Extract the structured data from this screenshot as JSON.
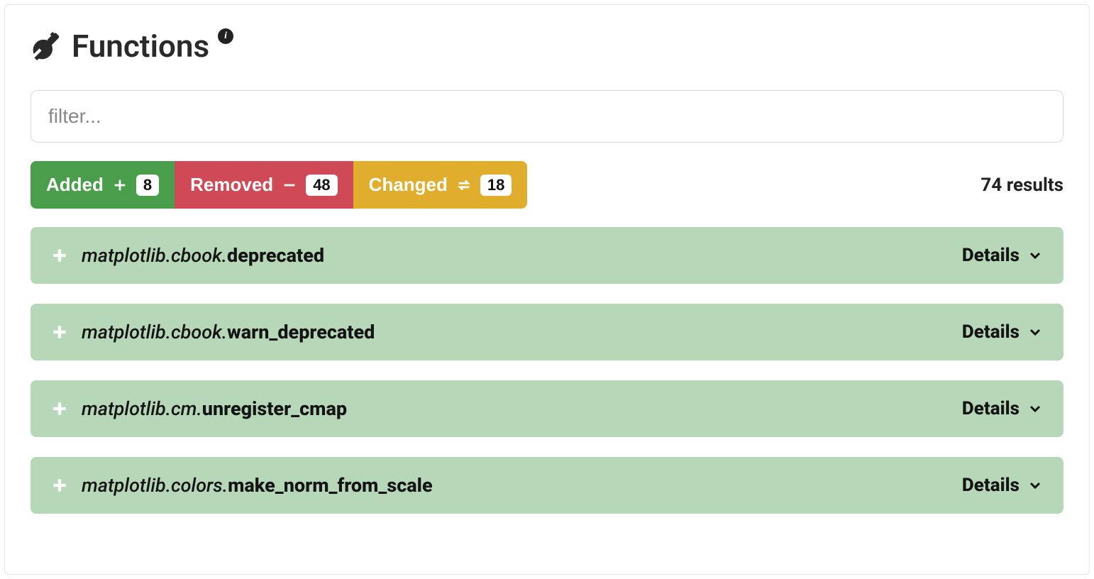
{
  "section": {
    "title": "Functions"
  },
  "filter": {
    "placeholder": "filter..."
  },
  "counts": {
    "added_label": "Added",
    "added_count": "8",
    "removed_label": "Removed",
    "removed_count": "48",
    "changed_label": "Changed",
    "changed_count": "18",
    "results_text": "74 results"
  },
  "details_label": "Details",
  "items": [
    {
      "module": "matplotlib.cbook.",
      "member": "deprecated"
    },
    {
      "module": "matplotlib.cbook.",
      "member": "warn_deprecated"
    },
    {
      "module": "matplotlib.cm.",
      "member": "unregister_cmap"
    },
    {
      "module": "matplotlib.colors.",
      "member": "make_norm_from_scale"
    }
  ]
}
